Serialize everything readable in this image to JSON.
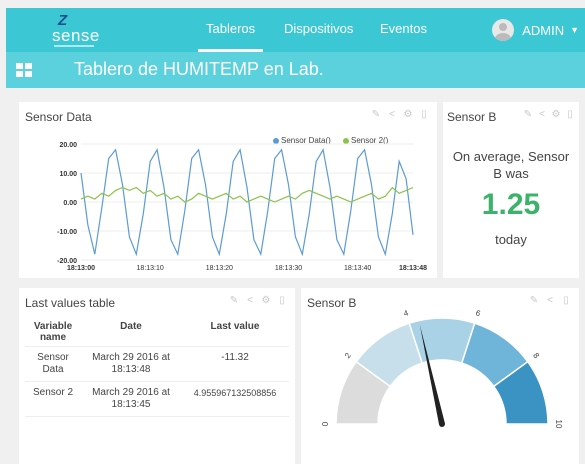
{
  "nav": {
    "logo_mark": "Z",
    "logo_text": "sense",
    "tabs": [
      {
        "label": "Tableros"
      },
      {
        "label": "Dispositivos"
      },
      {
        "label": "Eventos"
      }
    ],
    "user": "ADMIN"
  },
  "page": {
    "title": "Tablero de HUMITEMP en Lab."
  },
  "sensor_data_card": {
    "title": "Sensor Data",
    "legend": [
      "Sensor Data()",
      "Sensor 2()"
    ]
  },
  "sensor_b_avg": {
    "title": "Sensor B",
    "text": "On average, Sensor B was",
    "value": "1.25",
    "period": "today"
  },
  "last_values": {
    "title": "Last values table",
    "headers": [
      "Variable name",
      "Date",
      "Last value"
    ],
    "rows": [
      {
        "name": "Sensor Data",
        "date": "March 29 2016 at 18:13:48",
        "value": "-11.32"
      },
      {
        "name": "Sensor 2",
        "date": "March 29 2016 at 18:13:45",
        "value": "4.955967132508856"
      }
    ]
  },
  "gauge_card": {
    "title": "Sensor B",
    "ticks": [
      "0",
      "2",
      "4",
      "6",
      "8",
      "10"
    ],
    "value": 4.3,
    "min": 0,
    "max": 10
  },
  "colors": {
    "navbar": "#3cc7d5",
    "titlebar": "#5ad1dd",
    "series1": "#5b9bd5",
    "series2": "#8bc34a",
    "avg_value": "#3bb36a"
  },
  "chart_data": {
    "type": "line",
    "xlabel": "",
    "ylabel": "",
    "ylim": [
      -20,
      20
    ],
    "y_ticks": [
      "20.00",
      "10.00",
      "0.00",
      "-10.00",
      "-20.00"
    ],
    "x_ticks": [
      "18:13:00",
      "18:13:10",
      "18:13:20",
      "18:13:30",
      "18:13:40",
      "18:13:48"
    ],
    "x": [
      "18:13:00",
      "18:13:01",
      "18:13:02",
      "18:13:03",
      "18:13:04",
      "18:13:05",
      "18:13:06",
      "18:13:07",
      "18:13:08",
      "18:13:09",
      "18:13:10",
      "18:13:11",
      "18:13:12",
      "18:13:13",
      "18:13:14",
      "18:13:15",
      "18:13:16",
      "18:13:17",
      "18:13:18",
      "18:13:19",
      "18:13:20",
      "18:13:21",
      "18:13:22",
      "18:13:23",
      "18:13:24",
      "18:13:25",
      "18:13:26",
      "18:13:27",
      "18:13:28",
      "18:13:29",
      "18:13:30",
      "18:13:31",
      "18:13:32",
      "18:13:33",
      "18:13:34",
      "18:13:35",
      "18:13:36",
      "18:13:37",
      "18:13:38",
      "18:13:39",
      "18:13:40",
      "18:13:41",
      "18:13:42",
      "18:13:43",
      "18:13:44",
      "18:13:45",
      "18:13:46",
      "18:13:47",
      "18:13:48"
    ],
    "series": [
      {
        "name": "Sensor Data()",
        "color": "#5b9bd5",
        "values": [
          10,
          -8,
          -18,
          -2,
          15,
          18,
          6,
          -12,
          -18,
          -4,
          14,
          18,
          5,
          -13,
          -18,
          -3,
          15,
          18,
          6,
          -12,
          -18,
          -4,
          14,
          18,
          5,
          -13,
          -18,
          -3,
          15,
          18,
          6,
          -12,
          -18,
          -4,
          14,
          18,
          5,
          -13,
          -18,
          -3,
          15,
          18,
          6,
          -12,
          -18,
          -4,
          14,
          8,
          -11.32
        ]
      },
      {
        "name": "Sensor 2()",
        "color": "#8bc34a",
        "values": [
          1,
          2,
          1,
          3,
          2,
          4,
          5,
          4,
          5,
          3,
          4,
          2,
          3,
          1,
          2,
          0,
          1,
          3,
          2,
          1,
          2,
          3,
          1,
          2,
          0,
          1,
          2,
          1,
          0,
          1,
          2,
          1,
          3,
          4,
          3,
          2,
          1,
          2,
          1,
          0,
          1,
          2,
          3,
          1,
          2,
          4.96,
          3,
          4,
          5
        ]
      }
    ]
  }
}
